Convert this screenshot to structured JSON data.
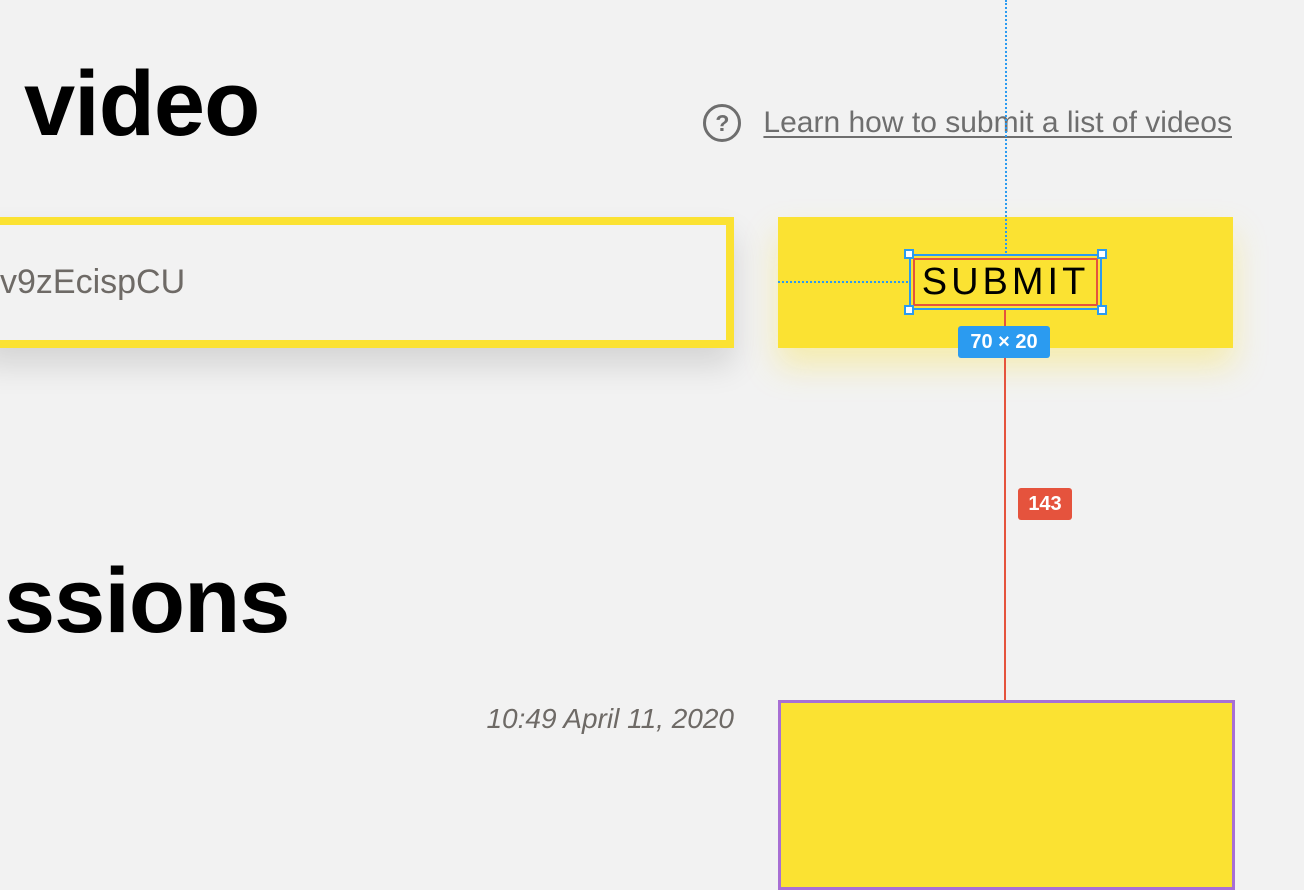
{
  "headings": {
    "submit_section": "video",
    "submissions_section": "ssions"
  },
  "help": {
    "icon": "question-circle-icon",
    "icon_glyph": "?",
    "link_text": "Learn how to submit a list of videos"
  },
  "form": {
    "url_value": "v9zEcispCU",
    "submit_label": "SUBMIT"
  },
  "submission": {
    "timestamp": "10:49 April 11, 2020"
  },
  "overlay": {
    "size_label": "70 × 20",
    "distance_label": "143"
  },
  "colors": {
    "accent_yellow": "#fbe232",
    "background": "#f2f2f2",
    "muted_text": "#6e6e6e",
    "guide_blue": "#2b9bf0",
    "guide_red": "#e5533d",
    "card_border": "#a86fd4"
  }
}
